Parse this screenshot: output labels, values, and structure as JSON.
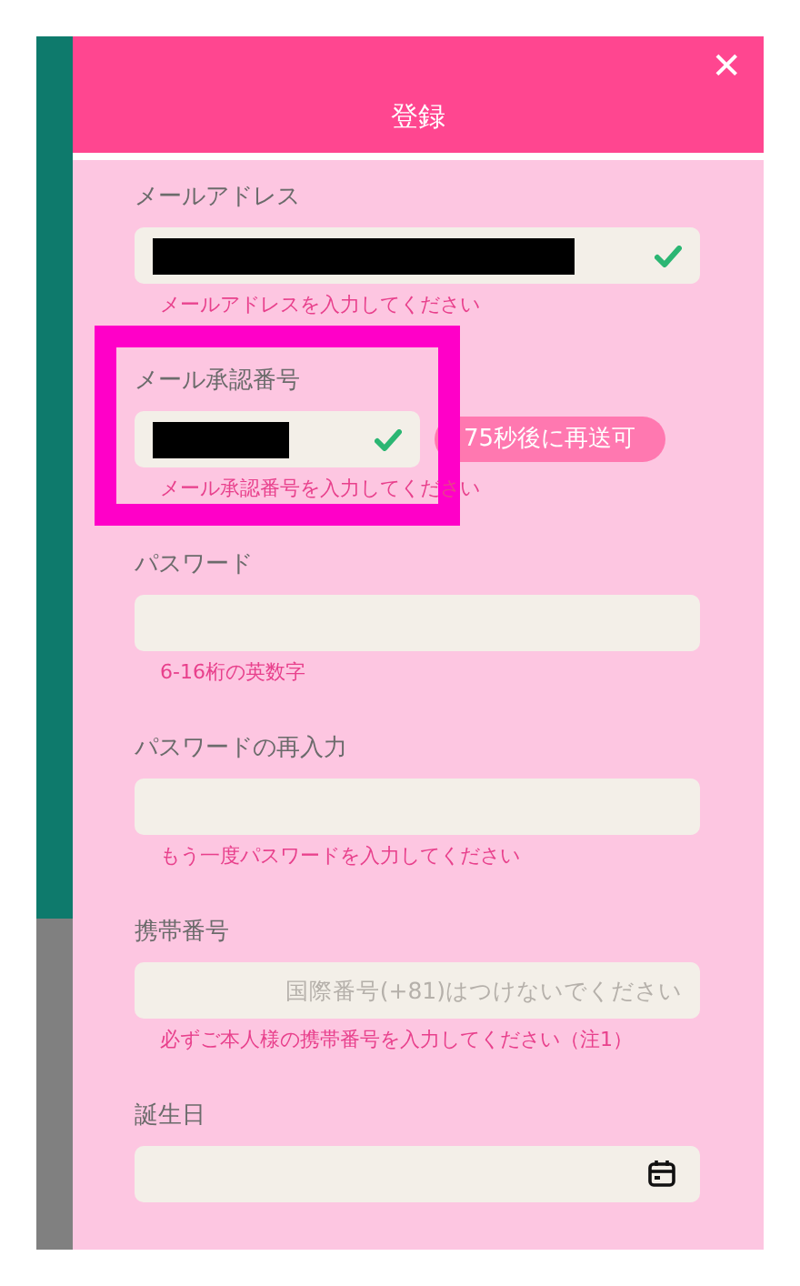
{
  "dialog": {
    "title": "登録",
    "close": "✕"
  },
  "fields": [
    {
      "kind": "text",
      "label": "メールアドレス",
      "redacted": true,
      "valid": true,
      "hint": "メールアドレスを入力してください"
    },
    {
      "kind": "code",
      "label": "メール承認番号",
      "redacted": true,
      "valid": true,
      "highlighted": true,
      "resend": "75秒後に再送可",
      "hint": "メール承認番号を入力してください"
    },
    {
      "kind": "text",
      "label": "パスワード",
      "hint": "6-16桁の英数字"
    },
    {
      "kind": "text",
      "label": "パスワードの再入力",
      "hint": "もう一度パスワードを入力してください"
    },
    {
      "kind": "text",
      "label": "携帯番号",
      "placeholder": "国際番号(+81)はつけないでください",
      "hint": "必ずご本人様の携帯番号を入力してください（注1）"
    },
    {
      "kind": "date",
      "label": "誕生日"
    }
  ]
}
